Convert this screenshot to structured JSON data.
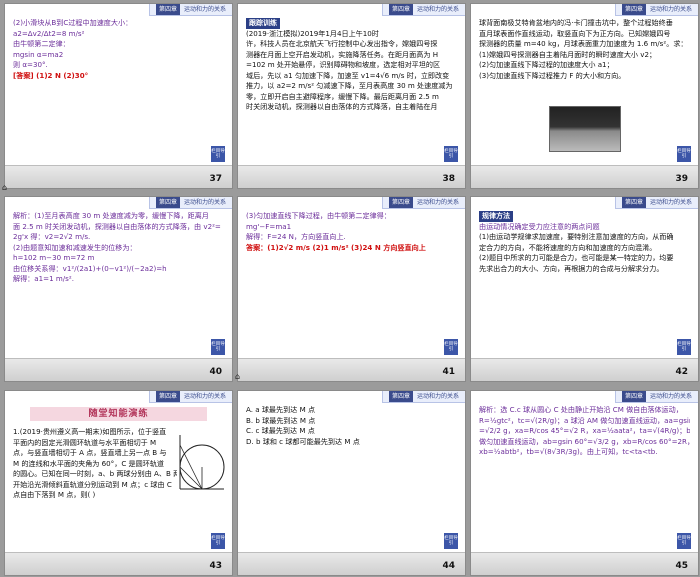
{
  "header": {
    "tag": "第四章",
    "title": "运动和力的关系"
  },
  "nav_label": "栏目导引",
  "slides": [
    {
      "page": "37",
      "lines": [
        {
          "t": "(2)小滑块从B到C过程中加速度大小：",
          "c": "purple"
        },
        {
          "t": "a2=Δv2/Δt2=8 m/s²",
          "c": "purple"
        },
        {
          "t": "由牛顿第二定律：",
          "c": "purple"
        },
        {
          "t": "mgsin α=ma2",
          "c": "purple"
        },
        {
          "t": "则 α=30°.",
          "c": "purple"
        },
        {
          "t": "[答案]  (1)2 N   (2)30°",
          "c": "red"
        }
      ]
    },
    {
      "page": "38",
      "tag": "跟踪训练",
      "lines": [
        {
          "t": "(2019·浙江模拟)2019年1月4日上午10时",
          "c": "blk"
        },
        {
          "t": "许，科技人员在北京航天飞行控制中心发出指令，嫦娥四号探",
          "c": "blk"
        },
        {
          "t": "测器在月面上空开启发动机，实施降落任务。在距月面高为 H",
          "c": "blk"
        },
        {
          "t": "=102 m 处开始悬停，识别障碍物和坡度，选定相对平坦的区",
          "c": "blk"
        },
        {
          "t": "域后，先以 a1 匀加速下降，加速至 v1=4√6 m/s 时，立即改变",
          "c": "blk"
        },
        {
          "t": "推力，以 a2=2 m/s² 匀减速下降，至月表高度 30 m 处速度减为",
          "c": "blk"
        },
        {
          "t": "零，立即开启自主避障程序，缓慢下降。最后距离月面 2.5 m",
          "c": "blk"
        },
        {
          "t": "时关闭发动机，探测器以自由落体的方式降落，自主着陆在月",
          "c": "blk"
        }
      ]
    },
    {
      "page": "39",
      "lines": [
        {
          "t": "球背面南极艾特肯盆地内的冯·卡门撞击坑中，整个过程始终垂",
          "c": "blk"
        },
        {
          "t": "直月球表面作直线运动，取竖直向下为正方向。已知嫦娥四号",
          "c": "blk"
        },
        {
          "t": "探测器的质量 m=40 kg，月球表面重力加速度为 1.6 m/s²。求：",
          "c": "blk"
        },
        {
          "t": "(1)嫦娥四号探测器自主着陆月面时的瞬时速度大小 v2；",
          "c": "blk"
        },
        {
          "t": "(2)匀加速直线下降过程的加速度大小 a1；",
          "c": "blk"
        },
        {
          "t": "(3)匀加速直线下降过程推力 F 的大小和方向。",
          "c": "blk"
        }
      ]
    },
    {
      "page": "40",
      "lines": [
        {
          "t": "解析：(1)至月表高度 30 m 处速度减为零，缓慢下降，距离月",
          "c": "purple"
        },
        {
          "t": "面 2.5 m 时关闭发动机，探测器以自由落体的方式降落，由 v2²=",
          "c": "purple"
        },
        {
          "t": "2g'x 得：v2=2√2 m/s.",
          "c": "purple"
        },
        {
          "t": "(2)由题意知加速和减速发生的位移为：",
          "c": "purple"
        },
        {
          "t": "h=102 m−30 m=72 m",
          "c": "purple"
        },
        {
          "t": "由位移关系得：v1²/(2a1)+(0−v1²)/(−2a2)=h",
          "c": "purple"
        },
        {
          "t": "解得：a1=1 m/s².",
          "c": "purple"
        }
      ]
    },
    {
      "page": "41",
      "lines": [
        {
          "t": "(3)匀加速直线下降过程，由牛顿第二定律得：",
          "c": "purple"
        },
        {
          "t": "mg'−F=ma1",
          "c": "purple"
        },
        {
          "t": "解得：F=24 N，方向竖直向上.",
          "c": "purple"
        },
        {
          "t": "答案：(1)2√2 m/s   (2)1 m/s²   (3)24 N   方向竖直向上",
          "c": "red"
        }
      ]
    },
    {
      "page": "42",
      "tag": "规律方法",
      "lines": [
        {
          "t": "由运动情况确定受力应注意的两点问题",
          "c": "purple"
        },
        {
          "t": "(1)由运动学规律求加速度，要特别注意加速度的方向，从而确",
          "c": "blk"
        },
        {
          "t": "定合力的方向，不能将速度的方向和加速度的方向混淆。",
          "c": "blk"
        },
        {
          "t": "(2)题目中所求的力可能是合力，也可能是某一特定的力，均要",
          "c": "blk"
        },
        {
          "t": "先求出合力的大小、方向，再根据力的合成与分解求分力。",
          "c": "blk"
        }
      ]
    },
    {
      "page": "43",
      "banner": "随堂知能演练",
      "lines": [
        {
          "t": "1.(2019·贵州遵义高一期末)如图所示，位于竖直",
          "c": "blk"
        },
        {
          "t": "平面内的固定光滑圆环轨道与水平面相切于 M",
          "c": "blk"
        },
        {
          "t": "点，与竖直墙相切于 A 点，竖直墙上另一点 B 与",
          "c": "blk"
        },
        {
          "t": "M 的连线和水平面的夹角为 60°，C 是圆环轨道",
          "c": "blk"
        },
        {
          "t": "的圆心。已知在同一时刻，a、b 两球分别由 A、B 两点从静止",
          "c": "blk"
        },
        {
          "t": "开始沿光滑倾斜直轨道分别运动到 M 点；c 球由 C",
          "c": "blk"
        },
        {
          "t": "点自由下落到 M 点，则(      )",
          "c": "blk"
        }
      ]
    },
    {
      "page": "44",
      "lines": [
        {
          "t": "A. a 球最先到达 M 点",
          "c": "blk"
        },
        {
          "t": "B. b 球最先到达 M 点",
          "c": "blk"
        },
        {
          "t": "C. c 球最先到达 M 点",
          "c": "blk"
        },
        {
          "t": "D. b 球和 c 球都可能最先到达 M 点",
          "c": "blk"
        }
      ]
    },
    {
      "page": "45",
      "lines": [
        {
          "t": "解析：选 C.c 球从圆心 C 处由静止开始沿 CM 做自由落体运动，",
          "c": "purple"
        },
        {
          "t": "R=½gtc²，tc=√(2R/g)；a 球沿 AM 做匀加速直线运动，aa=gsin 45°",
          "c": "purple"
        },
        {
          "t": "=√2/2 g，xa=R/cos 45°=√2 R，xa=½aata²，ta=√(4R/g)；b 球沿 BM",
          "c": "purple"
        },
        {
          "t": "做匀加速直线运动，ab=gsin 60°=√3/2 g，xb=R/cos 60°=2R，",
          "c": "purple"
        },
        {
          "t": "xb=½abtb²，tb=√(8√3R/3g)。由上可知，tc<ta<tb.",
          "c": "purple"
        }
      ]
    }
  ],
  "side_marks": {
    "s37": "⌂",
    "s40": "⌂"
  }
}
